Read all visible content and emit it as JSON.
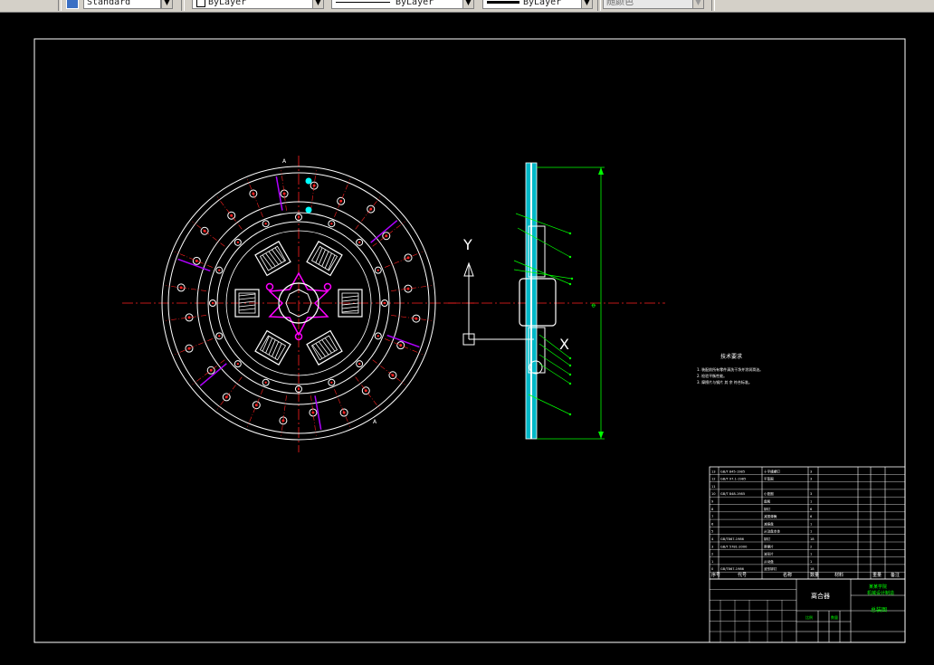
{
  "toolbar": {
    "text_style": "Standard",
    "layer": "ByLayer",
    "linetype": "ByLayer",
    "lineweight": "ByLayer",
    "color": "随颜色"
  },
  "drawing": {
    "axis_y_label": "Y",
    "axis_x_label": "X",
    "notes_title": "技术要求",
    "notes": [
      "1. 装配前所有零件清洗干净并涂润滑油。",
      "2. 检验平衡性能。",
      "3. 摩擦片与钢片 其 余 符合标准。"
    ],
    "title_block": {
      "part_name": "离合器",
      "school": "某某学院",
      "school_sub": "机械设计制造",
      "drawing_no": "总装图",
      "scale_label": "比例",
      "qty_label": "数量"
    },
    "bom_header": [
      "序号",
      "代号",
      "名称",
      "数量",
      "材料",
      "重量",
      "备注"
    ],
    "bom_rows": [
      [
        "13",
        "GB/T 845-1985",
        "十字槽螺钉",
        "3"
      ],
      [
        "12",
        "GB/T 97.1-1985",
        "平垫圈",
        "3"
      ],
      [
        "11",
        "",
        "",
        ""
      ],
      [
        "10",
        "GB/T 848-1985",
        "小垫圈",
        "3"
      ],
      [
        "9",
        "",
        "盘毂",
        "1"
      ],
      [
        "8",
        "",
        "铆钉",
        "6"
      ],
      [
        "7",
        "",
        "减振弹簧",
        "6"
      ],
      [
        "6",
        "",
        "减振盘",
        "1"
      ],
      [
        "5",
        "",
        "从动盘本体",
        "1"
      ],
      [
        "4",
        "GB/T867-1986",
        "铆钉",
        "18"
      ],
      [
        "3",
        "GB/T 5781-2000",
        "摩擦片",
        "2"
      ],
      [
        "2",
        "",
        "波形片",
        "1"
      ],
      [
        "1",
        "",
        "从动盘",
        "1"
      ],
      [
        "0",
        "GB/T867-1986",
        "波形铆钉",
        "18"
      ]
    ]
  }
}
